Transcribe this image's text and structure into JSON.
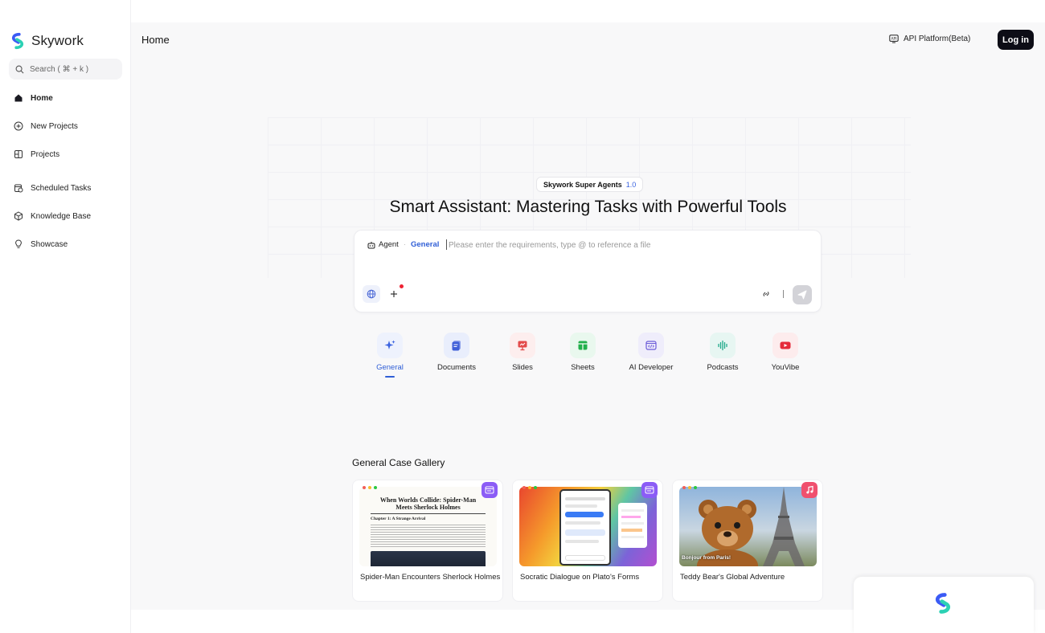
{
  "brand": {
    "name": "Skywork"
  },
  "search": {
    "placeholder": "Search ( ⌘ + k )"
  },
  "sidebar": {
    "items": [
      {
        "label": "Home",
        "icon": "home-icon",
        "active": true
      },
      {
        "label": "New Projects",
        "icon": "plus-circle-icon"
      },
      {
        "label": "Projects",
        "icon": "projects-icon"
      },
      {
        "label": "Scheduled Tasks",
        "icon": "calendar-clock-icon"
      },
      {
        "label": "Knowledge Base",
        "icon": "cube-icon"
      },
      {
        "label": "Showcase",
        "icon": "lightbulb-icon"
      }
    ]
  },
  "header": {
    "title": "Home",
    "api_label": "API Platform(Beta)",
    "login_label": "Log in"
  },
  "hero": {
    "badge_name": "Skywork Super Agents",
    "badge_version": "1.0",
    "title": "Smart Assistant: Mastering Tasks with Powerful Tools"
  },
  "composer": {
    "agent_label": "Agent",
    "agent_mode": "General",
    "placeholder": "Please enter the requirements, type @ to reference a file"
  },
  "modes": [
    {
      "label": "General",
      "active": true,
      "color": "#3a63e0",
      "bg": "#eef2fd"
    },
    {
      "label": "Documents",
      "color": "#3f5fd8",
      "bg": "#e9eefc"
    },
    {
      "label": "Slides",
      "color": "#e34a4a",
      "bg": "#fdeeee"
    },
    {
      "label": "Sheets",
      "color": "#22b04b",
      "bg": "#e9f8ee"
    },
    {
      "label": "AI Developer",
      "color": "#6b5bd8",
      "bg": "#efedfb"
    },
    {
      "label": "Podcasts",
      "color": "#1fa98a",
      "bg": "#e7f6f2"
    },
    {
      "label": "YouVibe",
      "color": "#e52a3a",
      "bg": "#fdeced"
    }
  ],
  "gallery": {
    "title": "General Case Gallery",
    "cards": [
      {
        "caption": "Spider-Man Encounters Sherlock Holmes",
        "doc_title": "When Worlds Collide: Spider-Man Meets Sherlock Holmes",
        "doc_chapter": "Chapter 1: A Strange Arrival",
        "badge_color": "#8b5cf6"
      },
      {
        "caption": "Socratic Dialogue on Plato's Forms",
        "badge_color": "#8b5cf6"
      },
      {
        "caption": "Teddy Bear's Global Adventure",
        "overlay_text": "Bonjour from Paris!",
        "badge_color": "#f0506e"
      }
    ]
  }
}
